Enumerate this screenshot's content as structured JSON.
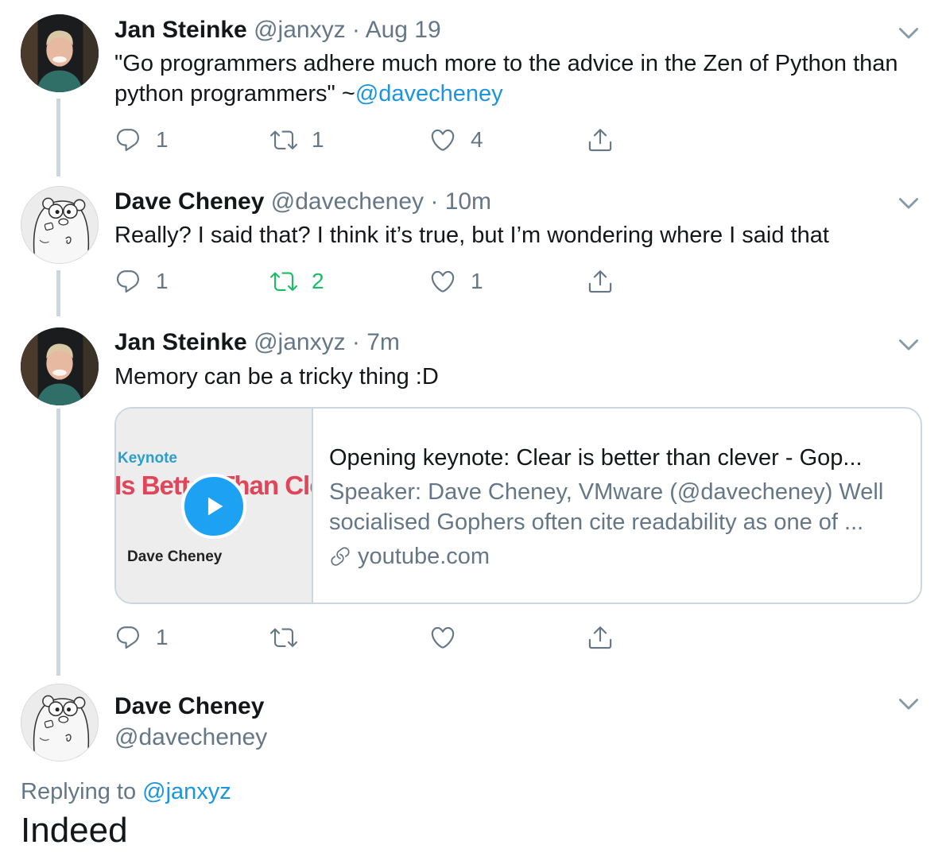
{
  "tweets": [
    {
      "name": "Jan Steinke",
      "meta": "@janxyz · Aug 19",
      "text_before": "\"Go programmers adhere much more to the advice in the Zen of Python than python programmers\" ~",
      "mention": "@davecheney",
      "replies": "1",
      "retweets": "1",
      "likes": "4"
    },
    {
      "name": "Dave Cheney",
      "meta": "@davecheney · 10m",
      "text": "Really? I said that? I think it’s true, but I’m wondering where I said that",
      "replies": "1",
      "retweets": "2",
      "retweeted": true,
      "likes": "1"
    },
    {
      "name": "Jan Steinke",
      "meta": "@janxyz · 7m",
      "text": "Memory can be a tricky thing :D",
      "replies": "1",
      "retweets": "",
      "likes": "",
      "card": {
        "thumb_keynote": "Keynote",
        "thumb_title": "Is Better Than Clear",
        "thumb_author": "Dave Cheney",
        "title": "Opening keynote: Clear is better than clever - Gop...",
        "description": "Speaker: Dave Cheney, VMware (@davecheney) Well socialised Gophers often cite readability as one of ...",
        "domain": "youtube.com"
      }
    }
  ],
  "compose": {
    "name": "Dave Cheney",
    "handle": "@davecheney",
    "replying_prefix": "Replying to ",
    "replying_to": "@janxyz",
    "text": "Indeed"
  },
  "colors": {
    "accent": "#1b95e0",
    "retweet_green": "#17bf63",
    "muted": "#657786",
    "thread_line": "#ccd6dd"
  },
  "icons": {
    "reply": "reply-icon",
    "retweet": "retweet-icon",
    "like": "heart-icon",
    "share": "share-icon",
    "caret": "chevron-down-icon",
    "play": "play-icon",
    "link": "link-icon"
  }
}
